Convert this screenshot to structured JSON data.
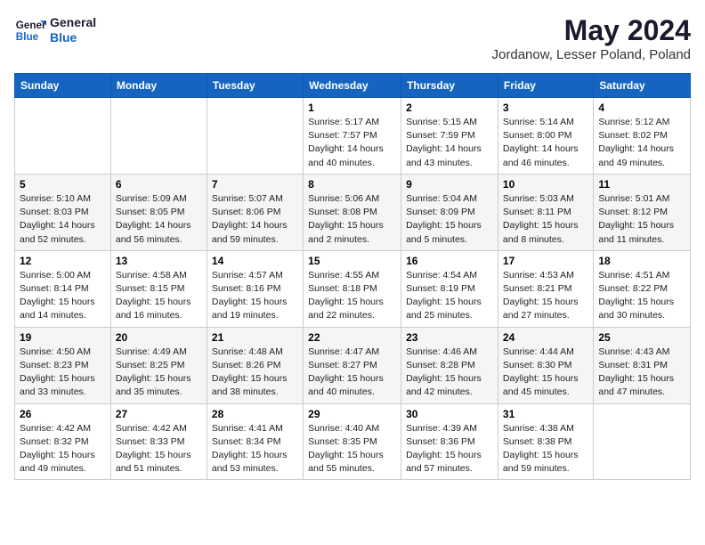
{
  "header": {
    "logo_line1": "General",
    "logo_line2": "Blue",
    "title": "May 2024",
    "subtitle": "Jordanow, Lesser Poland, Poland"
  },
  "weekdays": [
    "Sunday",
    "Monday",
    "Tuesday",
    "Wednesday",
    "Thursday",
    "Friday",
    "Saturday"
  ],
  "weeks": [
    [
      {
        "day": "",
        "info": ""
      },
      {
        "day": "",
        "info": ""
      },
      {
        "day": "",
        "info": ""
      },
      {
        "day": "1",
        "info": "Sunrise: 5:17 AM\nSunset: 7:57 PM\nDaylight: 14 hours\nand 40 minutes."
      },
      {
        "day": "2",
        "info": "Sunrise: 5:15 AM\nSunset: 7:59 PM\nDaylight: 14 hours\nand 43 minutes."
      },
      {
        "day": "3",
        "info": "Sunrise: 5:14 AM\nSunset: 8:00 PM\nDaylight: 14 hours\nand 46 minutes."
      },
      {
        "day": "4",
        "info": "Sunrise: 5:12 AM\nSunset: 8:02 PM\nDaylight: 14 hours\nand 49 minutes."
      }
    ],
    [
      {
        "day": "5",
        "info": "Sunrise: 5:10 AM\nSunset: 8:03 PM\nDaylight: 14 hours\nand 52 minutes."
      },
      {
        "day": "6",
        "info": "Sunrise: 5:09 AM\nSunset: 8:05 PM\nDaylight: 14 hours\nand 56 minutes."
      },
      {
        "day": "7",
        "info": "Sunrise: 5:07 AM\nSunset: 8:06 PM\nDaylight: 14 hours\nand 59 minutes."
      },
      {
        "day": "8",
        "info": "Sunrise: 5:06 AM\nSunset: 8:08 PM\nDaylight: 15 hours\nand 2 minutes."
      },
      {
        "day": "9",
        "info": "Sunrise: 5:04 AM\nSunset: 8:09 PM\nDaylight: 15 hours\nand 5 minutes."
      },
      {
        "day": "10",
        "info": "Sunrise: 5:03 AM\nSunset: 8:11 PM\nDaylight: 15 hours\nand 8 minutes."
      },
      {
        "day": "11",
        "info": "Sunrise: 5:01 AM\nSunset: 8:12 PM\nDaylight: 15 hours\nand 11 minutes."
      }
    ],
    [
      {
        "day": "12",
        "info": "Sunrise: 5:00 AM\nSunset: 8:14 PM\nDaylight: 15 hours\nand 14 minutes."
      },
      {
        "day": "13",
        "info": "Sunrise: 4:58 AM\nSunset: 8:15 PM\nDaylight: 15 hours\nand 16 minutes."
      },
      {
        "day": "14",
        "info": "Sunrise: 4:57 AM\nSunset: 8:16 PM\nDaylight: 15 hours\nand 19 minutes."
      },
      {
        "day": "15",
        "info": "Sunrise: 4:55 AM\nSunset: 8:18 PM\nDaylight: 15 hours\nand 22 minutes."
      },
      {
        "day": "16",
        "info": "Sunrise: 4:54 AM\nSunset: 8:19 PM\nDaylight: 15 hours\nand 25 minutes."
      },
      {
        "day": "17",
        "info": "Sunrise: 4:53 AM\nSunset: 8:21 PM\nDaylight: 15 hours\nand 27 minutes."
      },
      {
        "day": "18",
        "info": "Sunrise: 4:51 AM\nSunset: 8:22 PM\nDaylight: 15 hours\nand 30 minutes."
      }
    ],
    [
      {
        "day": "19",
        "info": "Sunrise: 4:50 AM\nSunset: 8:23 PM\nDaylight: 15 hours\nand 33 minutes."
      },
      {
        "day": "20",
        "info": "Sunrise: 4:49 AM\nSunset: 8:25 PM\nDaylight: 15 hours\nand 35 minutes."
      },
      {
        "day": "21",
        "info": "Sunrise: 4:48 AM\nSunset: 8:26 PM\nDaylight: 15 hours\nand 38 minutes."
      },
      {
        "day": "22",
        "info": "Sunrise: 4:47 AM\nSunset: 8:27 PM\nDaylight: 15 hours\nand 40 minutes."
      },
      {
        "day": "23",
        "info": "Sunrise: 4:46 AM\nSunset: 8:28 PM\nDaylight: 15 hours\nand 42 minutes."
      },
      {
        "day": "24",
        "info": "Sunrise: 4:44 AM\nSunset: 8:30 PM\nDaylight: 15 hours\nand 45 minutes."
      },
      {
        "day": "25",
        "info": "Sunrise: 4:43 AM\nSunset: 8:31 PM\nDaylight: 15 hours\nand 47 minutes."
      }
    ],
    [
      {
        "day": "26",
        "info": "Sunrise: 4:42 AM\nSunset: 8:32 PM\nDaylight: 15 hours\nand 49 minutes."
      },
      {
        "day": "27",
        "info": "Sunrise: 4:42 AM\nSunset: 8:33 PM\nDaylight: 15 hours\nand 51 minutes."
      },
      {
        "day": "28",
        "info": "Sunrise: 4:41 AM\nSunset: 8:34 PM\nDaylight: 15 hours\nand 53 minutes."
      },
      {
        "day": "29",
        "info": "Sunrise: 4:40 AM\nSunset: 8:35 PM\nDaylight: 15 hours\nand 55 minutes."
      },
      {
        "day": "30",
        "info": "Sunrise: 4:39 AM\nSunset: 8:36 PM\nDaylight: 15 hours\nand 57 minutes."
      },
      {
        "day": "31",
        "info": "Sunrise: 4:38 AM\nSunset: 8:38 PM\nDaylight: 15 hours\nand 59 minutes."
      },
      {
        "day": "",
        "info": ""
      }
    ]
  ]
}
